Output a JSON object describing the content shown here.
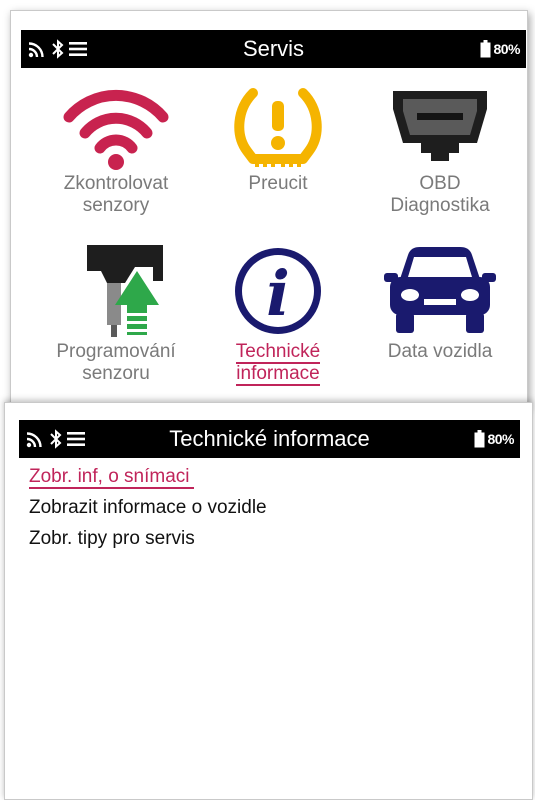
{
  "status_bar": {
    "battery": "80%",
    "icons": [
      "signal-icon",
      "bluetooth-icon",
      "menu-icon",
      "battery-icon"
    ]
  },
  "servis_screen": {
    "title": "Servis",
    "tiles": [
      {
        "line1": "Zkontrolovat",
        "line2": "senzory",
        "icon": "wifi-icon"
      },
      {
        "line1": "Preucit",
        "line2": "",
        "icon": "tpms-warning-icon"
      },
      {
        "line1": "OBD",
        "line2": "Diagnostika",
        "icon": "obd-connector-icon"
      },
      {
        "line1": "Programování",
        "line2": "senzoru",
        "icon": "sensor-program-icon"
      },
      {
        "line1": "Technické",
        "line2": "informace",
        "icon": "info-icon",
        "selected": true
      },
      {
        "line1": "Data vozidla",
        "line2": "",
        "icon": "car-icon"
      }
    ]
  },
  "tech_info_screen": {
    "title": "Technické informace",
    "items": [
      {
        "label": "Zobr. inf, o snímaci",
        "selected": true
      },
      {
        "label": "Zobrazit informace o vozidle"
      },
      {
        "label": "Zobr. tipy pro servis"
      }
    ]
  },
  "colors": {
    "accent": "#c0245a",
    "wifi": "#c8234f",
    "tpms": "#f5b400",
    "navy": "#1a1a6e",
    "green": "#2ea84a"
  }
}
